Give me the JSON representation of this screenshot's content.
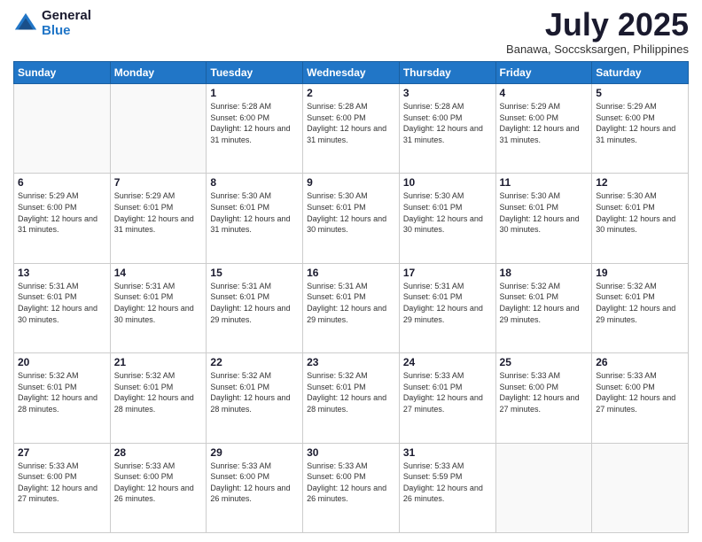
{
  "logo": {
    "general": "General",
    "blue": "Blue"
  },
  "title": {
    "month_year": "July 2025",
    "location": "Banawa, Soccsksargen, Philippines"
  },
  "weekdays": [
    "Sunday",
    "Monday",
    "Tuesday",
    "Wednesday",
    "Thursday",
    "Friday",
    "Saturday"
  ],
  "weeks": [
    [
      {
        "day": "",
        "empty": true
      },
      {
        "day": "",
        "empty": true
      },
      {
        "day": "1",
        "sunrise": "5:28 AM",
        "sunset": "6:00 PM",
        "daylight": "12 hours and 31 minutes."
      },
      {
        "day": "2",
        "sunrise": "5:28 AM",
        "sunset": "6:00 PM",
        "daylight": "12 hours and 31 minutes."
      },
      {
        "day": "3",
        "sunrise": "5:28 AM",
        "sunset": "6:00 PM",
        "daylight": "12 hours and 31 minutes."
      },
      {
        "day": "4",
        "sunrise": "5:29 AM",
        "sunset": "6:00 PM",
        "daylight": "12 hours and 31 minutes."
      },
      {
        "day": "5",
        "sunrise": "5:29 AM",
        "sunset": "6:00 PM",
        "daylight": "12 hours and 31 minutes."
      }
    ],
    [
      {
        "day": "6",
        "sunrise": "5:29 AM",
        "sunset": "6:00 PM",
        "daylight": "12 hours and 31 minutes."
      },
      {
        "day": "7",
        "sunrise": "5:29 AM",
        "sunset": "6:01 PM",
        "daylight": "12 hours and 31 minutes."
      },
      {
        "day": "8",
        "sunrise": "5:30 AM",
        "sunset": "6:01 PM",
        "daylight": "12 hours and 31 minutes."
      },
      {
        "day": "9",
        "sunrise": "5:30 AM",
        "sunset": "6:01 PM",
        "daylight": "12 hours and 30 minutes."
      },
      {
        "day": "10",
        "sunrise": "5:30 AM",
        "sunset": "6:01 PM",
        "daylight": "12 hours and 30 minutes."
      },
      {
        "day": "11",
        "sunrise": "5:30 AM",
        "sunset": "6:01 PM",
        "daylight": "12 hours and 30 minutes."
      },
      {
        "day": "12",
        "sunrise": "5:30 AM",
        "sunset": "6:01 PM",
        "daylight": "12 hours and 30 minutes."
      }
    ],
    [
      {
        "day": "13",
        "sunrise": "5:31 AM",
        "sunset": "6:01 PM",
        "daylight": "12 hours and 30 minutes."
      },
      {
        "day": "14",
        "sunrise": "5:31 AM",
        "sunset": "6:01 PM",
        "daylight": "12 hours and 30 minutes."
      },
      {
        "day": "15",
        "sunrise": "5:31 AM",
        "sunset": "6:01 PM",
        "daylight": "12 hours and 29 minutes."
      },
      {
        "day": "16",
        "sunrise": "5:31 AM",
        "sunset": "6:01 PM",
        "daylight": "12 hours and 29 minutes."
      },
      {
        "day": "17",
        "sunrise": "5:31 AM",
        "sunset": "6:01 PM",
        "daylight": "12 hours and 29 minutes."
      },
      {
        "day": "18",
        "sunrise": "5:32 AM",
        "sunset": "6:01 PM",
        "daylight": "12 hours and 29 minutes."
      },
      {
        "day": "19",
        "sunrise": "5:32 AM",
        "sunset": "6:01 PM",
        "daylight": "12 hours and 29 minutes."
      }
    ],
    [
      {
        "day": "20",
        "sunrise": "5:32 AM",
        "sunset": "6:01 PM",
        "daylight": "12 hours and 28 minutes."
      },
      {
        "day": "21",
        "sunrise": "5:32 AM",
        "sunset": "6:01 PM",
        "daylight": "12 hours and 28 minutes."
      },
      {
        "day": "22",
        "sunrise": "5:32 AM",
        "sunset": "6:01 PM",
        "daylight": "12 hours and 28 minutes."
      },
      {
        "day": "23",
        "sunrise": "5:32 AM",
        "sunset": "6:01 PM",
        "daylight": "12 hours and 28 minutes."
      },
      {
        "day": "24",
        "sunrise": "5:33 AM",
        "sunset": "6:01 PM",
        "daylight": "12 hours and 27 minutes."
      },
      {
        "day": "25",
        "sunrise": "5:33 AM",
        "sunset": "6:00 PM",
        "daylight": "12 hours and 27 minutes."
      },
      {
        "day": "26",
        "sunrise": "5:33 AM",
        "sunset": "6:00 PM",
        "daylight": "12 hours and 27 minutes."
      }
    ],
    [
      {
        "day": "27",
        "sunrise": "5:33 AM",
        "sunset": "6:00 PM",
        "daylight": "12 hours and 27 minutes."
      },
      {
        "day": "28",
        "sunrise": "5:33 AM",
        "sunset": "6:00 PM",
        "daylight": "12 hours and 26 minutes."
      },
      {
        "day": "29",
        "sunrise": "5:33 AM",
        "sunset": "6:00 PM",
        "daylight": "12 hours and 26 minutes."
      },
      {
        "day": "30",
        "sunrise": "5:33 AM",
        "sunset": "6:00 PM",
        "daylight": "12 hours and 26 minutes."
      },
      {
        "day": "31",
        "sunrise": "5:33 AM",
        "sunset": "5:59 PM",
        "daylight": "12 hours and 26 minutes."
      },
      {
        "day": "",
        "empty": true
      },
      {
        "day": "",
        "empty": true
      }
    ]
  ]
}
